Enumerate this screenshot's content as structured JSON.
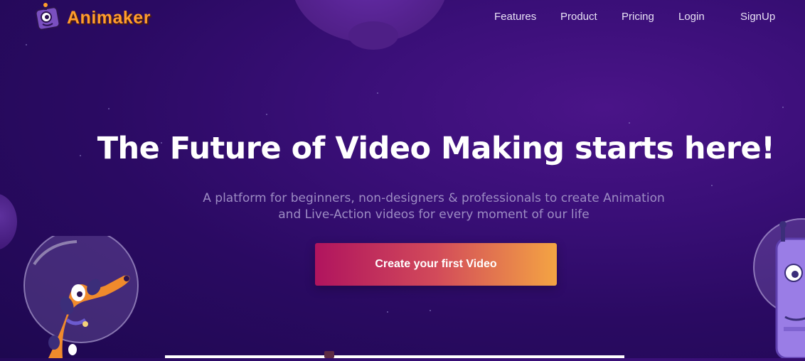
{
  "brand": {
    "name": "Animaker",
    "accent": "#ff9d2b"
  },
  "nav": {
    "items": [
      "Features",
      "Product",
      "Pricing",
      "Login",
      "SignUp"
    ]
  },
  "hero": {
    "title": "The Future of Video Making starts here!",
    "subtitle_line1": "A platform for beginners, non-designers & professionals to create Animation",
    "subtitle_line2": "and Live-Action videos for every moment of our life",
    "cta_label": "Create your first Video"
  },
  "colors": {
    "background": "#2a0a62",
    "cta_start": "#b0145e",
    "cta_end": "#f4a443"
  },
  "icons": [
    "animaker-logo-icon",
    "astronaut-dog-illustration",
    "robot-illustration",
    "planet-illustration"
  ]
}
